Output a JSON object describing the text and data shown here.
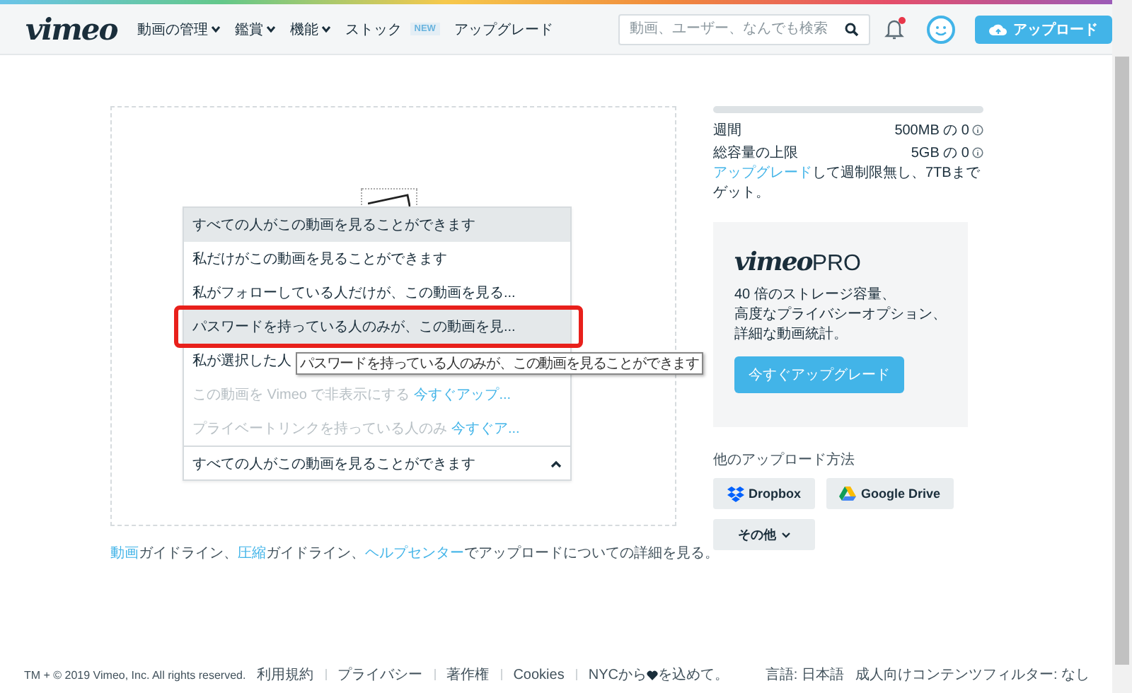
{
  "header": {
    "logo": "vimeo",
    "nav": [
      {
        "label": "動画の管理",
        "dropdown": true
      },
      {
        "label": "鑑賞",
        "dropdown": true
      },
      {
        "label": "機能",
        "dropdown": true
      },
      {
        "label": "ストック",
        "dropdown": false,
        "badge": "NEW"
      },
      {
        "label": "アップグレード",
        "dropdown": false
      }
    ],
    "search": {
      "placeholder": "動画、ユーザー、なんでも検索"
    },
    "notification": {
      "unread": true
    },
    "upload_button": "アップロード"
  },
  "privacy_menu": {
    "options": [
      {
        "label": "すべての人がこの動画を見ることができます",
        "highlighted": true,
        "annotated": false,
        "disabled": false
      },
      {
        "label": "私だけがこの動画を見ることができます",
        "highlighted": false,
        "annotated": false,
        "disabled": false
      },
      {
        "label": "私がフォローしている人だけが、この動画を見る...",
        "highlighted": false,
        "annotated": false,
        "disabled": false
      },
      {
        "label": "パスワードを持っている人のみが、この動画を見...",
        "highlighted": true,
        "annotated": true,
        "disabled": false
      },
      {
        "label": "私が選択した人",
        "highlighted": false,
        "annotated": false,
        "disabled": false
      },
      {
        "label": "この動画を Vimeo で非表示にする",
        "highlighted": false,
        "annotated": false,
        "disabled": true,
        "link": "今すぐアップ..."
      },
      {
        "label": "プライベートリンクを持っている人のみ",
        "highlighted": false,
        "annotated": false,
        "disabled": true,
        "link": "今すぐア..."
      }
    ],
    "tooltip": "パスワードを持っている人のみが、この動画を見ることができます",
    "value": "すべての人がこの動画を見ることができます"
  },
  "help_text": [
    {
      "text": "動画",
      "link": true
    },
    {
      "text": "ガイドライン、",
      "link": false
    },
    {
      "text": "圧縮",
      "link": true
    },
    {
      "text": "ガイドライン、",
      "link": false
    },
    {
      "text": "ヘルプセンター",
      "link": true
    },
    {
      "text": "でアップロードについての詳細を見る。",
      "link": false
    }
  ],
  "quota": {
    "level": 0,
    "rows": [
      {
        "label": "週間",
        "value": "500MB の 0"
      },
      {
        "label": "総容量の上限",
        "value": "5GB の 0"
      }
    ],
    "upgrade_link": "アップグレード",
    "upgrade_text": "して週制限無し、7TBまでゲット。"
  },
  "pro_card": {
    "logo": "vimeo",
    "logo_suffix": "PRO",
    "lines": [
      "40 倍のストレージ容量、",
      "高度なプライバシーオプション、",
      "詳細な動画統計。"
    ],
    "button": "今すぐアップグレード"
  },
  "other_methods": {
    "title": "他のアップロード方法",
    "buttons": [
      {
        "kind": "dropbox",
        "label": "Dropbox"
      },
      {
        "kind": "drive",
        "label": "Google Drive"
      },
      {
        "kind": "more",
        "label": "その他"
      }
    ]
  },
  "footer": {
    "left": [
      "TM + © 2019 Vimeo, Inc. All rights reserved.",
      "利用規約",
      "プライバシー",
      "著作権",
      "Cookies"
    ],
    "love_before": "NYCから",
    "love_after": "を込めて。",
    "right": [
      "言語: 日本語",
      "成人向けコンテンツフィルター: なし"
    ]
  }
}
